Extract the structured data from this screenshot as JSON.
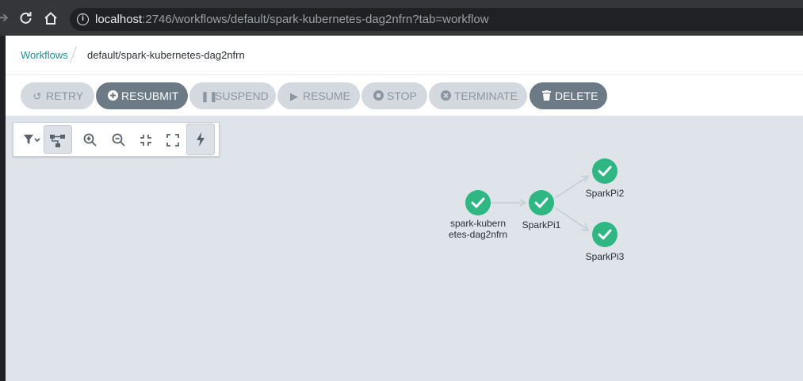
{
  "browser": {
    "url_host": "localhost",
    "url_rest": ":2746/workflows/default/spark-kubernetes-dag2nfrn?tab=workflow"
  },
  "breadcrumb": {
    "root": "Workflows",
    "current": "default/spark-kubernetes-dag2nfrn"
  },
  "toolbar": {
    "retry": "RETRY",
    "resubmit": "RESUBMIT",
    "suspend": "SUSPEND",
    "resume": "RESUME",
    "stop": "STOP",
    "terminate": "TERMINATE",
    "delete": "DELETE"
  },
  "graph": {
    "nodes": [
      {
        "id": "root",
        "label_line1": "spark-kubern",
        "label_line2": "etes-dag2nfrn",
        "status": "succeeded"
      },
      {
        "id": "sp1",
        "label": "SparkPi1",
        "status": "succeeded"
      },
      {
        "id": "sp2",
        "label": "SparkPi2",
        "status": "succeeded"
      },
      {
        "id": "sp3",
        "label": "SparkPi3",
        "status": "succeeded"
      }
    ],
    "edges": [
      [
        "root",
        "sp1"
      ],
      [
        "sp1",
        "sp2"
      ],
      [
        "sp1",
        "sp3"
      ]
    ]
  },
  "colors": {
    "success": "#2fb783",
    "canvas": "#dee4ea",
    "link": "#1f8f9b"
  }
}
